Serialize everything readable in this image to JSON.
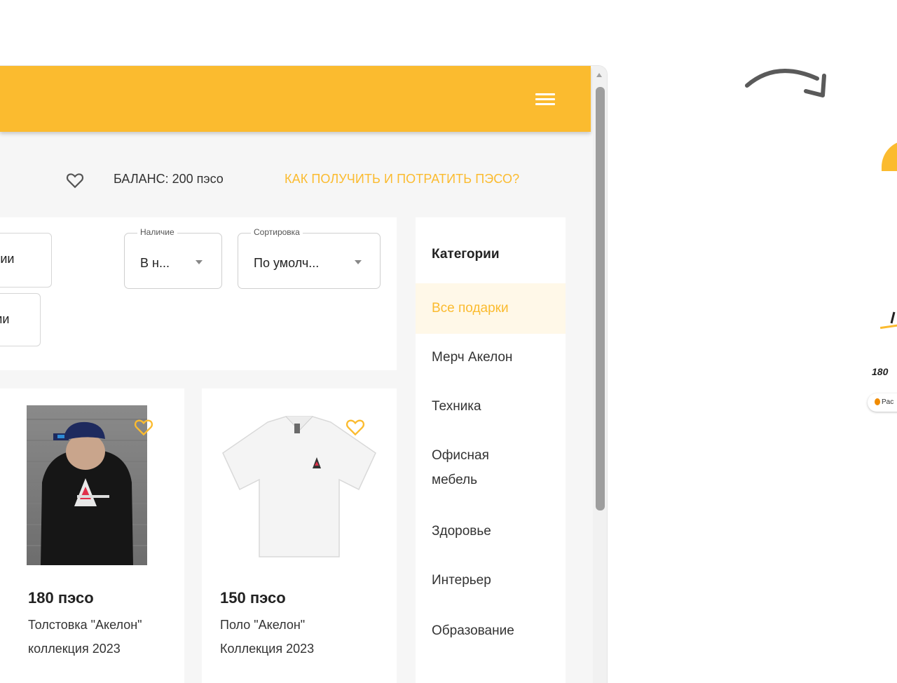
{
  "header": {
    "menu_icon": "hamburger-icon"
  },
  "balance_bar": {
    "favorite_icon": "heart-outline-icon",
    "balance_text": "БАЛАНС: 200 пэсо",
    "help_link": "КАК ПОЛУЧИТЬ И ПОТРАТИТЬ ПЭСО?"
  },
  "filters": {
    "chip_1": "чии",
    "chip_2": "ми",
    "availability": {
      "label": "Наличие",
      "value": "В н..."
    },
    "sorting": {
      "label": "Сортировка",
      "value": "По умолч..."
    }
  },
  "products": [
    {
      "price": "180 пэсо",
      "title_line1": "Толстовка \"Акелон\"",
      "title_line2": "коллекция 2023",
      "image": "hoodie-photo"
    },
    {
      "price": "150 пэсо",
      "title_line1": "Поло \"Акелон\"",
      "title_line2": "Коллекция 2023",
      "image": "polo-shirt-photo"
    }
  ],
  "categories": {
    "heading": "Категории",
    "items": [
      "Все подарки",
      "Мерч Акелон",
      "Техника",
      "Офисная мебель",
      "Здоровье",
      "Интерьер",
      "Образование"
    ],
    "active_index": 0
  },
  "decor": {
    "price_fragment": "180",
    "pill_fragment": "Pac"
  },
  "colors": {
    "accent": "#fbbb2f",
    "active_bg": "#fff8e8"
  }
}
